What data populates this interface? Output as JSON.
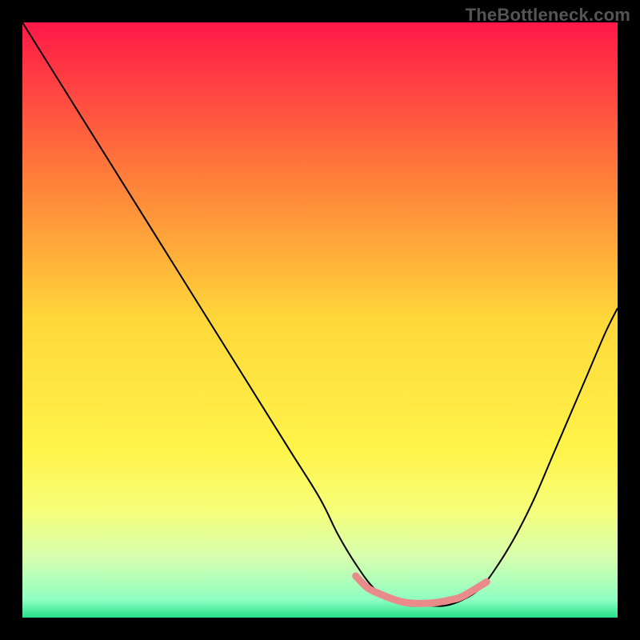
{
  "watermark": "TheBottleneck.com",
  "chart_data": {
    "type": "line",
    "title": "",
    "xlabel": "",
    "ylabel": "",
    "xlim": [
      0,
      100
    ],
    "ylim": [
      0,
      100
    ],
    "grid": false,
    "legend": false,
    "background_gradient": {
      "stops": [
        {
          "offset": 0,
          "color": "#ff1848"
        },
        {
          "offset": 25,
          "color": "#ff7a3a"
        },
        {
          "offset": 50,
          "color": "#ffd83a"
        },
        {
          "offset": 72,
          "color": "#fff44a"
        },
        {
          "offset": 82,
          "color": "#f6ff7a"
        },
        {
          "offset": 90,
          "color": "#d6ffb0"
        },
        {
          "offset": 97,
          "color": "#8fffc2"
        },
        {
          "offset": 100,
          "color": "#28e08a"
        }
      ]
    },
    "series": [
      {
        "name": "bottleneck-curve",
        "color": "#000000",
        "width": 2,
        "x": [
          0,
          5,
          10,
          15,
          20,
          25,
          30,
          35,
          40,
          45,
          50,
          53,
          56,
          59,
          62,
          65,
          68,
          71,
          74,
          77,
          80,
          83,
          86,
          89,
          92,
          95,
          98,
          100
        ],
        "y": [
          100,
          92,
          84,
          76,
          68,
          60,
          52,
          44,
          36,
          28,
          20,
          14,
          9,
          5,
          3,
          2,
          2,
          2,
          3,
          5,
          9,
          14,
          20,
          27,
          34,
          41,
          48,
          52
        ]
      },
      {
        "name": "highlight-band",
        "color": "#e98b8b",
        "width": 9,
        "linecap": "round",
        "x": [
          56,
          58,
          60,
          62,
          64,
          66,
          68,
          70,
          72,
          74,
          78
        ],
        "y": [
          7.0,
          5.0,
          4.0,
          3.2,
          2.6,
          2.4,
          2.4,
          2.6,
          3.0,
          3.6,
          6.0
        ]
      }
    ],
    "annotations": []
  }
}
